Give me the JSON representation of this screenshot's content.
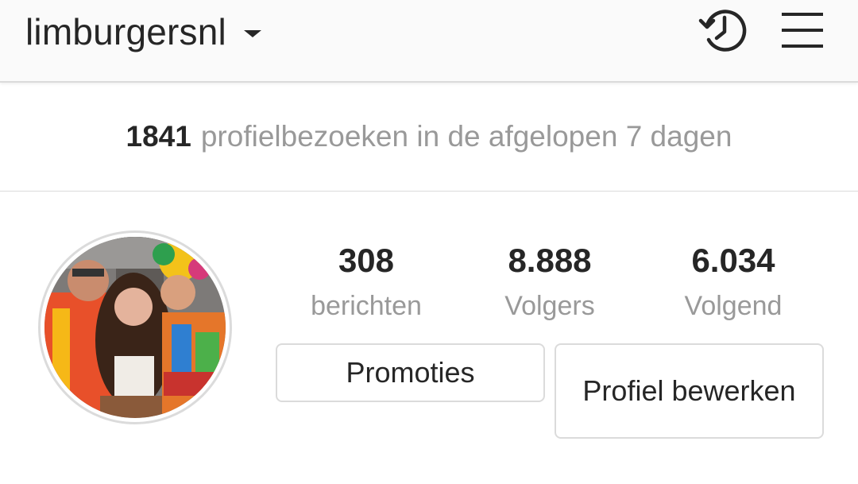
{
  "header": {
    "username": "limburgersnl",
    "account_switch_icon": "chevron-down-icon",
    "history_icon": "history-icon",
    "menu_icon": "hamburger-menu-icon"
  },
  "insights": {
    "visits_count": "1841",
    "visits_text": "profielbezoeken in de afgelopen 7 dagen"
  },
  "profile": {
    "avatar": "avatar",
    "stats": [
      {
        "value": "308",
        "label": "berichten"
      },
      {
        "value": "8.888",
        "label": "Volgers"
      },
      {
        "value": "6.034",
        "label": "Volgend"
      }
    ],
    "promotions_label": "Promoties",
    "edit_profile_label": "Profiel bewerken"
  },
  "colors": {
    "text_primary": "#262626",
    "text_secondary": "#999999",
    "border": "#dbdbdb",
    "header_bg": "#fafafa"
  }
}
